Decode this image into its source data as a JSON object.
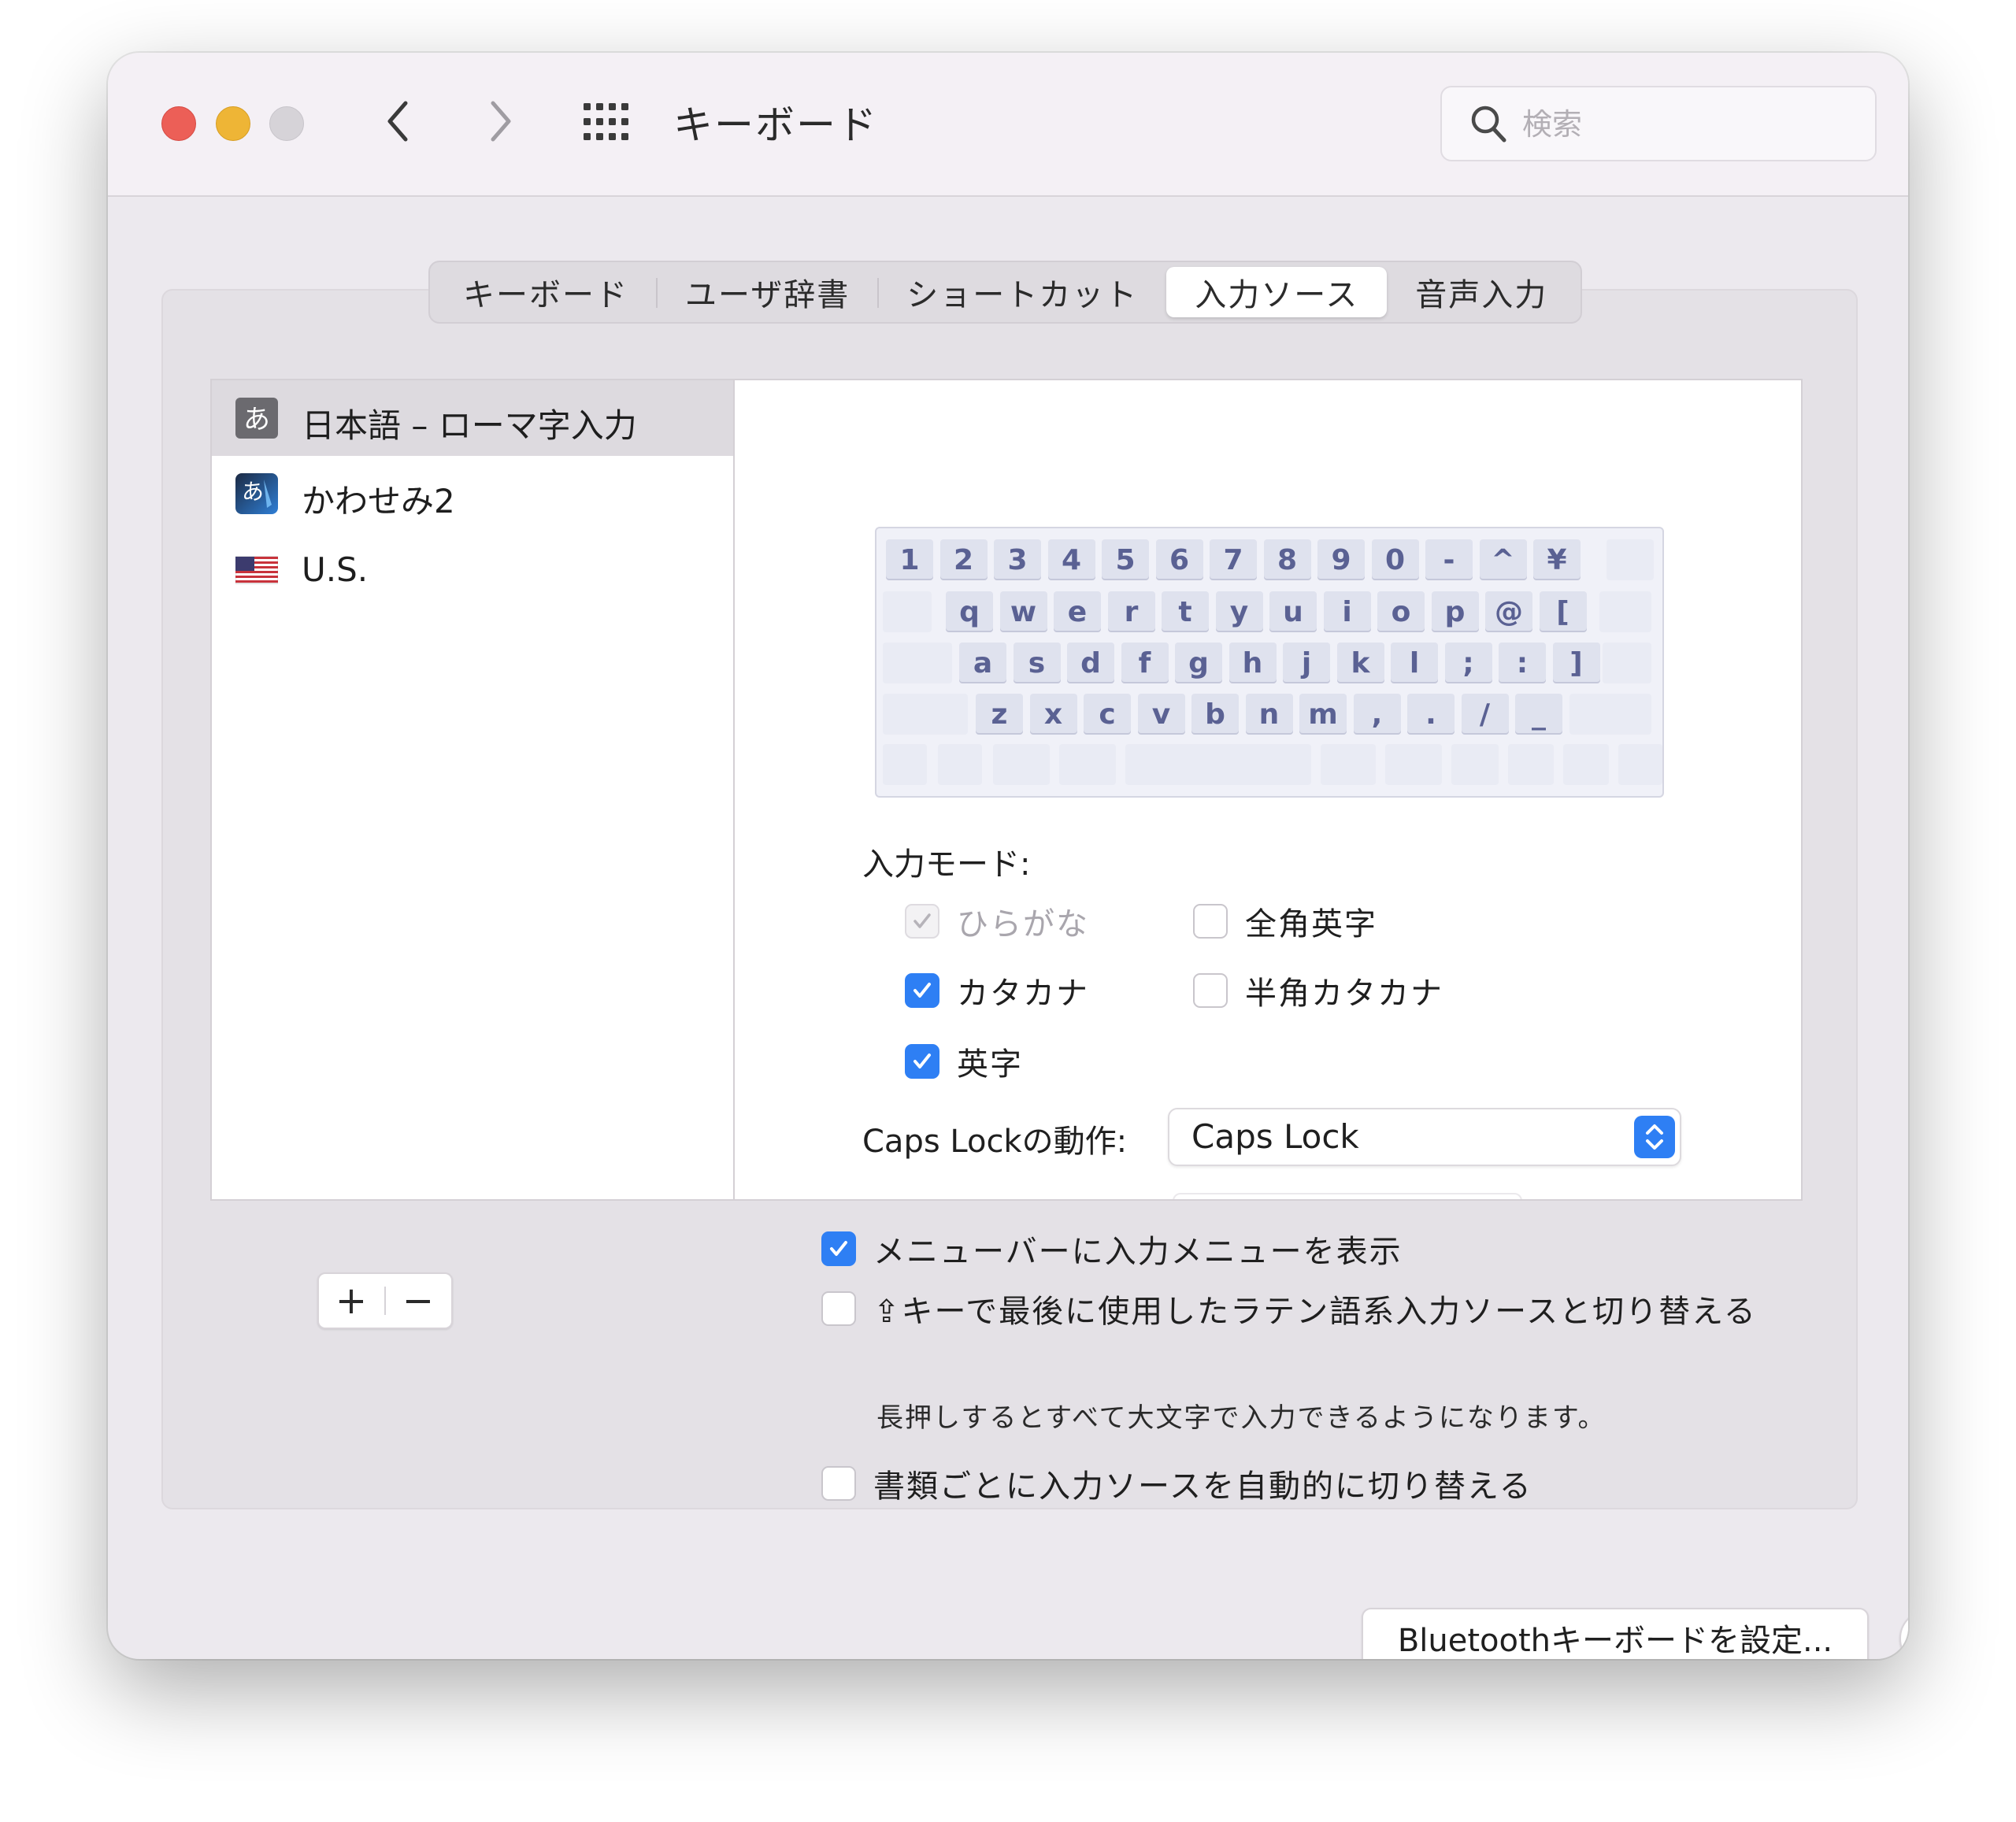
{
  "window": {
    "title": "キーボード",
    "search_placeholder": "検索"
  },
  "tabs": [
    {
      "label": "キーボード",
      "selected": false
    },
    {
      "label": "ユーザ辞書",
      "selected": false
    },
    {
      "label": "ショートカット",
      "selected": false
    },
    {
      "label": "入力ソース",
      "selected": true
    },
    {
      "label": "音声入力",
      "selected": false
    }
  ],
  "input_sources": [
    {
      "label": "日本語 – ローマ字入力",
      "icon": "hiragana-a-icon",
      "selected": true
    },
    {
      "label": "かわせみ2",
      "icon": "kawasemi-icon",
      "selected": false
    },
    {
      "label": "U.S.",
      "icon": "us-flag-icon",
      "selected": false
    }
  ],
  "keyboard_layout": {
    "rows": [
      [
        "1",
        "2",
        "3",
        "4",
        "5",
        "6",
        "7",
        "8",
        "9",
        "0",
        "-",
        "^",
        "¥"
      ],
      [
        "q",
        "w",
        "e",
        "r",
        "t",
        "y",
        "u",
        "i",
        "o",
        "p",
        "@",
        "["
      ],
      [
        "a",
        "s",
        "d",
        "f",
        "g",
        "h",
        "j",
        "k",
        "l",
        ";",
        ":",
        "]"
      ],
      [
        "z",
        "x",
        "c",
        "v",
        "b",
        "n",
        "m",
        ",",
        ".",
        "/",
        "_"
      ]
    ]
  },
  "input_mode": {
    "label": "入力モード:",
    "options": [
      {
        "label": "ひらがな",
        "checked": true,
        "disabled": true
      },
      {
        "label": "全角英字",
        "checked": false,
        "disabled": false
      },
      {
        "label": "カタカナ",
        "checked": true,
        "disabled": false
      },
      {
        "label": "半角カタカナ",
        "checked": false,
        "disabled": false
      },
      {
        "label": "英字",
        "checked": true,
        "disabled": false
      }
    ]
  },
  "caps_lock": {
    "label": "Caps Lockの動作:",
    "value": "Caps Lock"
  },
  "list_buttons": {
    "add": "+",
    "remove": "−"
  },
  "options": {
    "show_menu": {
      "label": "メニューバーに入力メニューを表示",
      "checked": true
    },
    "shift_switch": {
      "label": "⇪キーで最後に使用したラテン語系入力ソースと切り替える",
      "checked": false,
      "note": "長押しするとすべて大文字で入力できるようになります。"
    },
    "auto_switch": {
      "label": "書類ごとに入力ソースを自動的に切り替える",
      "checked": false
    }
  },
  "bottom": {
    "bluetooth_button": "Bluetoothキーボードを設定...",
    "help_button": "?"
  },
  "colors": {
    "accent": "#2e7ff4",
    "close": "#ec5f57",
    "minimize": "#eeb536"
  }
}
